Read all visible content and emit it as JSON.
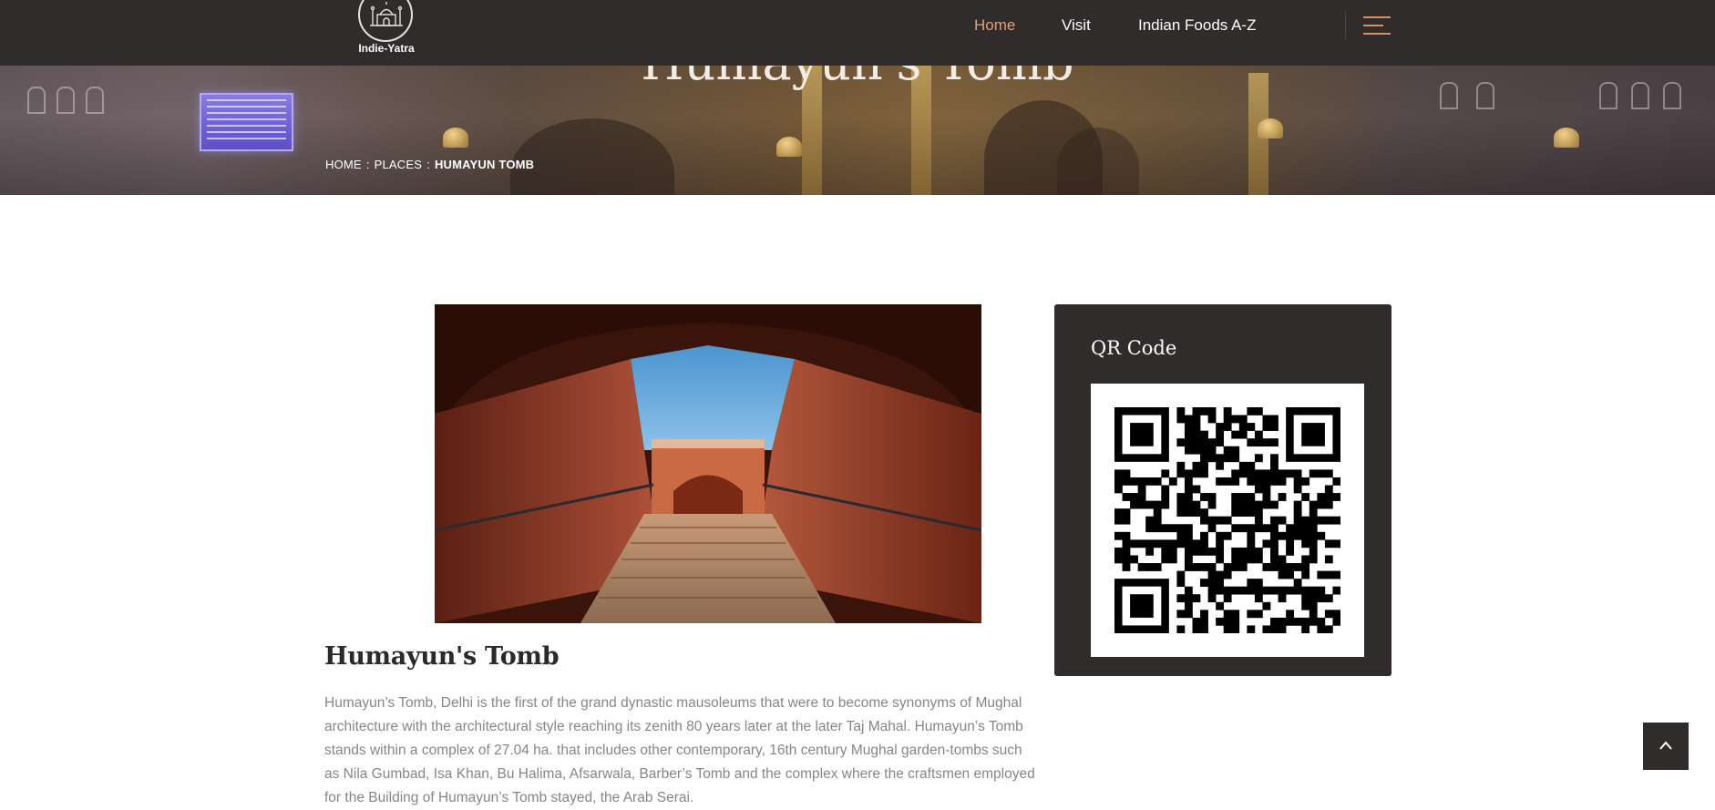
{
  "brand": {
    "name": "Indie-Yatra"
  },
  "nav": {
    "home": "Home",
    "visit": "Visit",
    "foods": "Indian Foods A-Z"
  },
  "hero": {
    "title": "Humayun's Tomb",
    "breadcrumb": {
      "home": "HOME",
      "places": "PLACES",
      "current": "HUMAYUN TOMB",
      "separator": ":"
    }
  },
  "article": {
    "title": "Humayun's Tomb",
    "body": "Humayun’s Tomb, Delhi is the first of the grand dynastic mausoleums that were to become synonyms of Mughal architecture with the architectural style reaching its zenith 80 years later at the later Taj Mahal. Humayun’s Tomb stands within a complex of 27.04 ha. that includes other contemporary, 16th century Mughal garden-tombs such as Nila Gumbad, Isa Khan, Bu Halima, Afsarwala, Barber’s Tomb and the complex where the craftsmen employed for the Building of Humayun’s Tomb stayed, the Arab Serai."
  },
  "sidebar": {
    "title": "QR Code"
  },
  "colors": {
    "navbar_bg": "#2f2c2b",
    "accent": "#e0a07a",
    "body_text": "#8a8583"
  },
  "icons": {
    "logo": "mosque-icon",
    "menu": "hamburger-menu-icon",
    "back_to_top": "chevron-up-icon"
  }
}
